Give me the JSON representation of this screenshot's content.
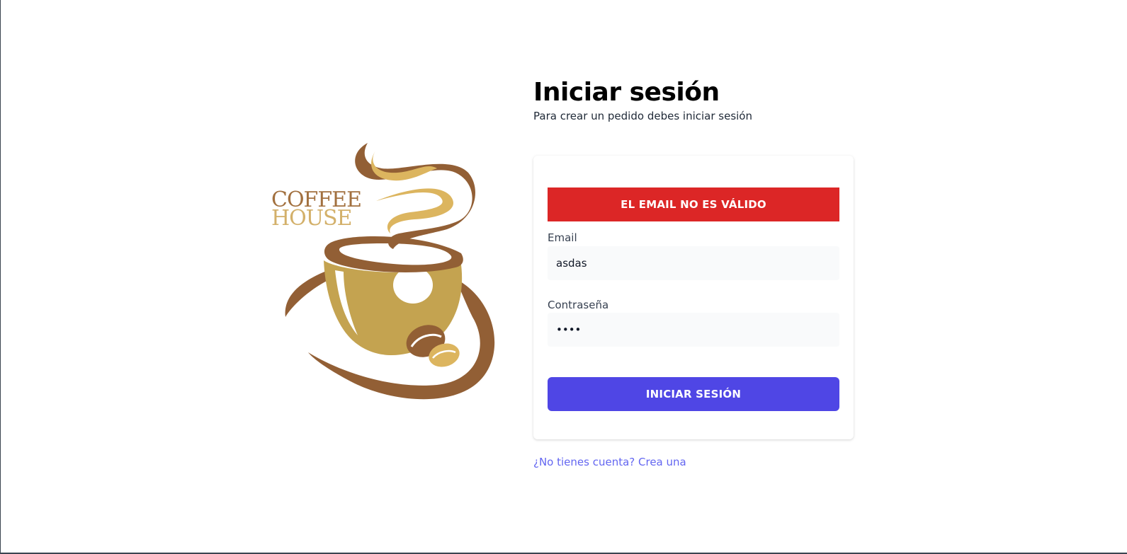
{
  "logo": {
    "line1": "COFFEE",
    "line2": "HOUSE",
    "colors": {
      "brown": "#925f35",
      "gold": "#c4a350",
      "light_gold": "#dcb55f",
      "text_top": "#a2703f",
      "text_bottom": "#d3b06a"
    }
  },
  "header": {
    "title": "Iniciar sesión",
    "subtitle": "Para crear un pedido debes iniciar sesión"
  },
  "form": {
    "alert": "EL EMAIL NO ES VÁLIDO",
    "email_label": "Email",
    "email_value": "asdas",
    "password_label": "Contraseña",
    "password_value": "asda",
    "submit_label": "INICIAR SESIÓN"
  },
  "footer": {
    "register_link": "¿No tienes cuenta? Crea una"
  },
  "colors": {
    "alert_bg": "#dc2626",
    "primary": "#4f46e5",
    "link": "#6366f1"
  }
}
